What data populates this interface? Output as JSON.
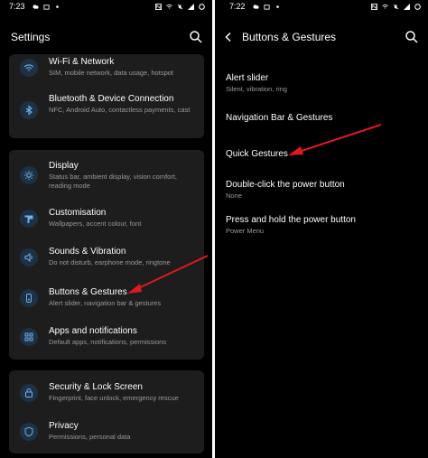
{
  "left": {
    "status": {
      "time": "7:23"
    },
    "title": "Settings",
    "cards": [
      {
        "rows": [
          {
            "title": "Wi-Fi & Network",
            "subtitle": "SIM, mobile network, data usage, hotspot",
            "icon": "wifi-icon"
          },
          {
            "title": "Bluetooth & Device Connection",
            "subtitle": "NFC, Android Auto, contactless payments, cast",
            "icon": "bluetooth-icon"
          }
        ]
      },
      {
        "rows": [
          {
            "title": "Display",
            "subtitle": "Status bar, ambient display, vision comfort, reading mode",
            "icon": "brightness-icon"
          },
          {
            "title": "Customisation",
            "subtitle": "Wallpapers, accent colour, font",
            "icon": "palette-icon"
          },
          {
            "title": "Sounds & Vibration",
            "subtitle": "Do not disturb, earphone mode, ringtone",
            "icon": "speaker-icon"
          },
          {
            "title": "Buttons & Gestures",
            "subtitle": "Alert slider, navigation bar & gestures",
            "icon": "gesture-icon"
          },
          {
            "title": "Apps and notifications",
            "subtitle": "Default apps, notifications, permissions",
            "icon": "apps-grid-icon"
          }
        ]
      },
      {
        "rows": [
          {
            "title": "Security & Lock Screen",
            "subtitle": "Fingerprint, face unlock, emergency rescue",
            "icon": "lock-icon"
          },
          {
            "title": "Privacy",
            "subtitle": "Permissions, personal data",
            "icon": "shield-icon"
          }
        ]
      }
    ]
  },
  "right": {
    "status": {
      "time": "7:22"
    },
    "title": "Buttons & Gestures",
    "items": [
      {
        "title": "Alert slider",
        "subtitle": "Silent, vibration, ring"
      },
      {
        "title": "Navigation Bar & Gestures",
        "subtitle": ""
      },
      {
        "title": "Quick Gestures",
        "subtitle": ""
      },
      {
        "title": "Double-click the power button",
        "subtitle": "None"
      },
      {
        "title": "Press and hold the power button",
        "subtitle": "Power Menu"
      }
    ]
  },
  "colors": {
    "background": "#000000",
    "card": "#1d1d1d",
    "icon_circle": "#1c3144",
    "icon_glyph": "#6fb3ea",
    "annotation_arrow": "#e0191f"
  }
}
